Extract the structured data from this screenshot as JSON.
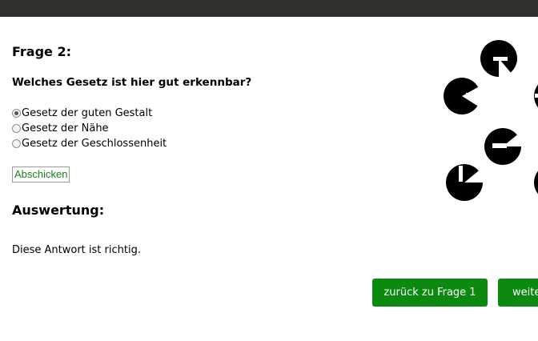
{
  "question": {
    "title": "Frage 2:",
    "text": "Welches Gesetz ist hier gut erkennbar?",
    "options": [
      {
        "label": "Gesetz der guten Gestalt",
        "selected": true
      },
      {
        "label": "Gesetz der Nähe",
        "selected": false
      },
      {
        "label": "Gesetz der Geschlossenheit",
        "selected": false
      }
    ],
    "submit_label": "Abschicken"
  },
  "evaluation": {
    "title": "Auswertung:",
    "result": "Diese Antwort ist richtig."
  },
  "navigation": {
    "back_label": "zurück zu Frage 1",
    "next_label": "weite"
  },
  "colors": {
    "topbar": "#2f2f2d",
    "button_green": "#0c8a10",
    "submit_text": "#1a7f1a"
  }
}
